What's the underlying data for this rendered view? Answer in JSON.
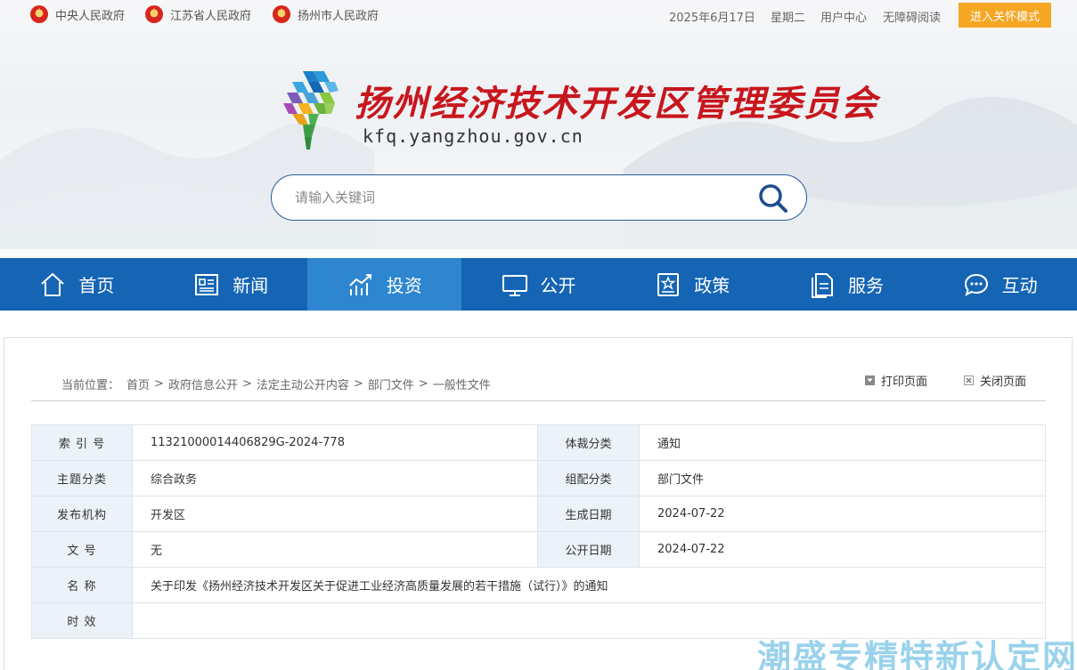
{
  "topbar": {
    "gov_links": [
      {
        "label": "中央人民政府"
      },
      {
        "label": "江苏省人民政府"
      },
      {
        "label": "扬州市人民政府"
      }
    ],
    "date": "2025年6月17日",
    "weekday": "星期二",
    "user_center": "用户中心",
    "accessible": "无障碍阅读",
    "care_mode": "进入关怀模式"
  },
  "header": {
    "title": "扬州经济技术开发区管理委员会",
    "domain": "kfq.yangzhou.gov.cn"
  },
  "search": {
    "placeholder": "请输入关键词"
  },
  "nav": {
    "items": [
      {
        "label": "首页",
        "icon": "home-icon"
      },
      {
        "label": "新闻",
        "icon": "news-icon"
      },
      {
        "label": "投资",
        "icon": "invest-chart-icon"
      },
      {
        "label": "公开",
        "icon": "monitor-icon"
      },
      {
        "label": "政策",
        "icon": "policy-book-icon"
      },
      {
        "label": "服务",
        "icon": "document-icon"
      },
      {
        "label": "互动",
        "icon": "chat-icon"
      }
    ],
    "active_index": 2
  },
  "breadcrumb": {
    "prefix": "当前位置：",
    "items": [
      "首页",
      "政府信息公开",
      "法定主动公开内容",
      "部门文件",
      "一般性文件"
    ],
    "separator": ">"
  },
  "tools": {
    "print": "打印页面",
    "close": "关闭页面"
  },
  "meta": {
    "index_no_label": "索 引 号",
    "index_no": "11321000014406829G-2024-778",
    "genre_label": "体裁分类",
    "genre": "通知",
    "topic_label": "主题分类",
    "topic": "综合政务",
    "config_label": "组配分类",
    "config": "部门文件",
    "issuer_label": "发布机构",
    "issuer": "开发区",
    "created_label": "生成日期",
    "created": "2024-07-22",
    "docno_label": "文 号",
    "docno": "无",
    "published_label": "公开日期",
    "published": "2024-07-22",
    "name_label": "名 称",
    "name": "关于印发《扬州经济技术开发区关于促进工业经济高质量发展的若干措施（试行）》的通知",
    "validity_label": "时 效",
    "validity": ""
  },
  "watermark": "潮盛专精特新认定网",
  "colors": {
    "nav_bg": "#1565b4",
    "nav_active": "#2d86cf",
    "care_btn": "#f5a623",
    "title_red": "#c8161d",
    "table_key_bg": "#ecf2f9"
  }
}
